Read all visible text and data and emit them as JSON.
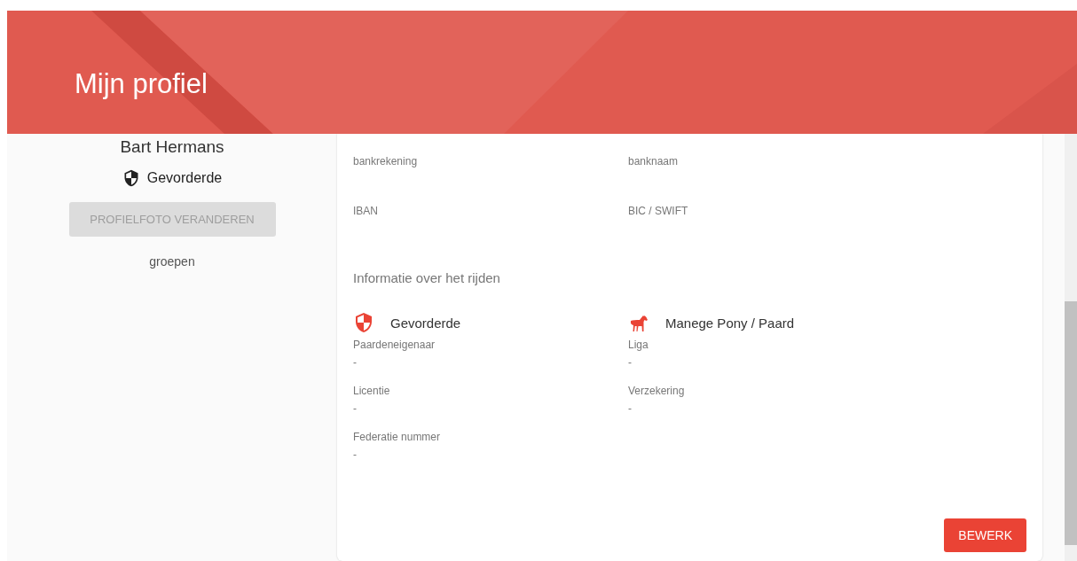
{
  "header": {
    "title": "Mijn profiel"
  },
  "sidebar": {
    "name": "Bart Hermans",
    "level": "Gevorderde",
    "photo_button": {
      "label": "PROFIELFOTO VERANDEREN",
      "disabled": true
    },
    "groups_label": "groepen"
  },
  "bank_fields": [
    {
      "label": "bankrekening"
    },
    {
      "label": "banknaam"
    },
    {
      "label": "IBAN"
    },
    {
      "label": "BIC / SWIFT"
    }
  ],
  "riding": {
    "heading": "Informatie over het rijden",
    "badges": [
      {
        "kind": "shield",
        "label": "Gevorderde"
      },
      {
        "kind": "horse",
        "label": "Manege Pony / Paard"
      }
    ],
    "fields": [
      {
        "label": "Paardeneigenaar",
        "value": "-"
      },
      {
        "label": "Liga",
        "value": "-"
      },
      {
        "label": "Licentie",
        "value": "-"
      },
      {
        "label": "Verzekering",
        "value": "-"
      },
      {
        "label": "Federatie nummer",
        "value": "-"
      }
    ]
  },
  "edit_button": {
    "label": "BEWERK"
  }
}
